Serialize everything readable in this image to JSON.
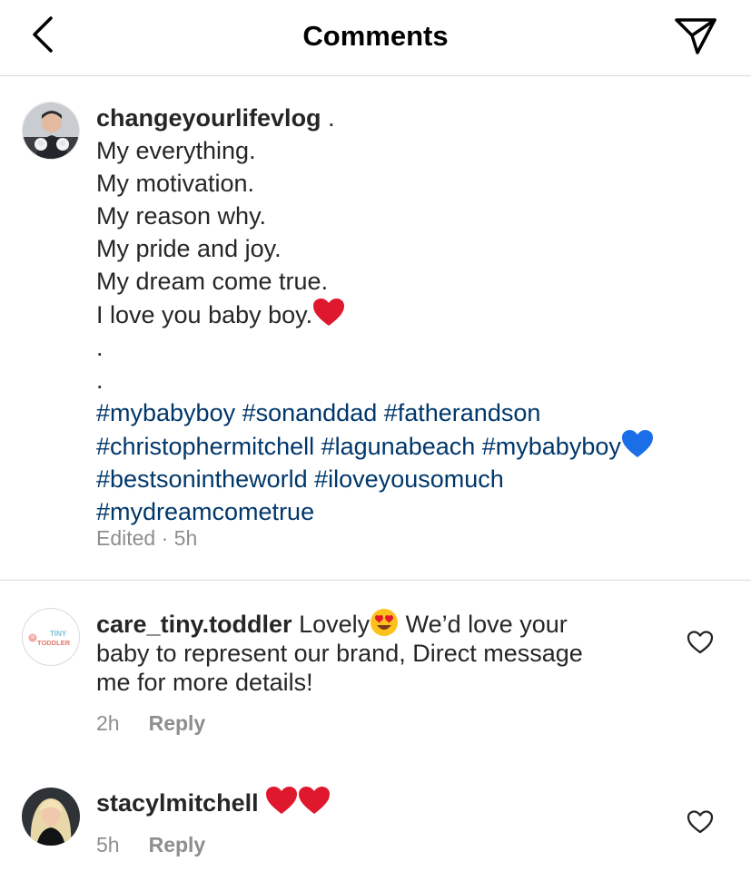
{
  "header": {
    "title": "Comments",
    "back_icon": "chevron-left-icon",
    "send_icon": "paper-plane-icon"
  },
  "caption": {
    "username": "changeyourlifevlog",
    "username_suffix": " .",
    "lines": [
      "My everything.",
      "My motivation.",
      "My reason why.",
      "My pride and joy.",
      "My dream come true.",
      "I love you baby boy."
    ],
    "dots": [
      ".",
      "."
    ],
    "hashtag_lines": [
      "#mybabyboy #sonanddad #fatherandson",
      "#christophermitchell #lagunabeach #mybabyboy",
      "#bestsonintheworld #iloveyousomuch",
      "#mydreamcometrue"
    ],
    "meta": "Edited · 5h"
  },
  "comments": [
    {
      "username": "care_tiny.toddler",
      "text_before_emoji": " Lovely",
      "text_line1_after": "  We’d love your",
      "text_line2": "baby to represent our brand, Direct message",
      "text_line3": "me for more details!",
      "time": "2h",
      "reply_label": "Reply",
      "avatar_logo_top": "TINY",
      "avatar_logo_bottom": "TODDLER"
    },
    {
      "username": "stacylmitchell",
      "time": "5h",
      "reply_label": "Reply"
    }
  ],
  "colors": {
    "hashtag": "#00376b",
    "muted": "#8e8e8e",
    "text": "#262626",
    "heart_red": "#e0182d",
    "heart_blue": "#1a6ee8",
    "divider": "#dbdbdb"
  }
}
